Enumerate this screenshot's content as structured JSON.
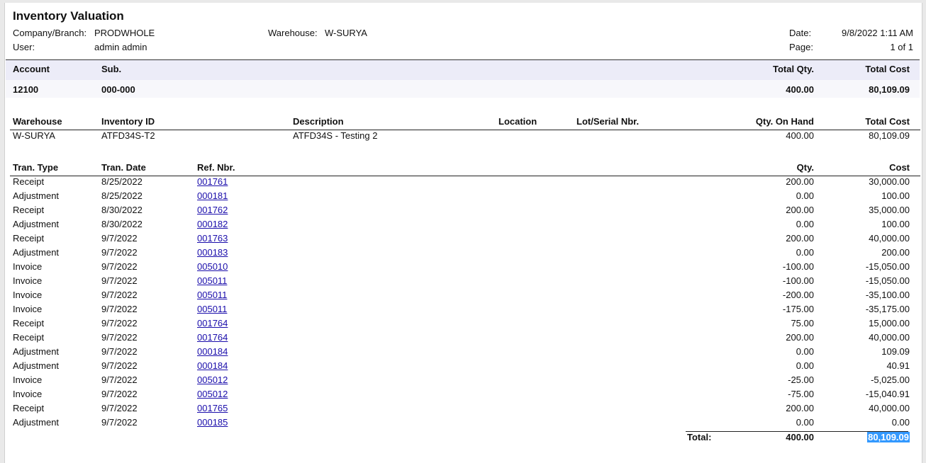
{
  "report": {
    "title": "Inventory Valuation",
    "company_label": "Company/Branch:",
    "company_value": "PRODWHOLE",
    "user_label": "User:",
    "user_value": "admin admin",
    "warehouse_label": "Warehouse:",
    "warehouse_value": "W-SURYA",
    "date_label": "Date:",
    "date_value": "9/8/2022 1:11 AM",
    "page_label": "Page:",
    "page_value": "1 of 1"
  },
  "account_header": {
    "account": "Account",
    "sub": "Sub.",
    "total_qty": "Total Qty.",
    "total_cost": "Total Cost"
  },
  "account_row": {
    "account": "12100",
    "sub": "000-000",
    "total_qty": "400.00",
    "total_cost": "80,109.09"
  },
  "item_header": {
    "warehouse": "Warehouse",
    "inventory_id": "Inventory ID",
    "description": "Description",
    "location": "Location",
    "lot_serial": "Lot/Serial Nbr.",
    "qty_on_hand": "Qty. On Hand",
    "total_cost": "Total Cost"
  },
  "item_row": {
    "warehouse": "W-SURYA",
    "inventory_id": "ATFD34S-T2",
    "description": "ATFD34S - Testing 2",
    "qty_on_hand": "400.00",
    "total_cost": "80,109.09"
  },
  "tran_header": {
    "type": "Tran. Type",
    "date": "Tran. Date",
    "ref": "Ref. Nbr.",
    "qty": "Qty.",
    "cost": "Cost"
  },
  "transactions": [
    {
      "type": "Receipt",
      "date": "8/25/2022",
      "ref": "001761",
      "qty": "200.00",
      "cost": "30,000.00"
    },
    {
      "type": "Adjustment",
      "date": "8/25/2022",
      "ref": "000181",
      "qty": "0.00",
      "cost": "100.00"
    },
    {
      "type": "Receipt",
      "date": "8/30/2022",
      "ref": "001762",
      "qty": "200.00",
      "cost": "35,000.00"
    },
    {
      "type": "Adjustment",
      "date": "8/30/2022",
      "ref": "000182",
      "qty": "0.00",
      "cost": "100.00"
    },
    {
      "type": "Receipt",
      "date": "9/7/2022",
      "ref": "001763",
      "qty": "200.00",
      "cost": "40,000.00"
    },
    {
      "type": "Adjustment",
      "date": "9/7/2022",
      "ref": "000183",
      "qty": "0.00",
      "cost": "200.00"
    },
    {
      "type": "Invoice",
      "date": "9/7/2022",
      "ref": "005010",
      "qty": "-100.00",
      "cost": "-15,050.00"
    },
    {
      "type": "Invoice",
      "date": "9/7/2022",
      "ref": "005011",
      "qty": "-100.00",
      "cost": "-15,050.00"
    },
    {
      "type": "Invoice",
      "date": "9/7/2022",
      "ref": "005011",
      "qty": "-200.00",
      "cost": "-35,100.00"
    },
    {
      "type": "Invoice",
      "date": "9/7/2022",
      "ref": "005011",
      "qty": "-175.00",
      "cost": "-35,175.00"
    },
    {
      "type": "Receipt",
      "date": "9/7/2022",
      "ref": "001764",
      "qty": "75.00",
      "cost": "15,000.00"
    },
    {
      "type": "Receipt",
      "date": "9/7/2022",
      "ref": "001764",
      "qty": "200.00",
      "cost": "40,000.00"
    },
    {
      "type": "Adjustment",
      "date": "9/7/2022",
      "ref": "000184",
      "qty": "0.00",
      "cost": "109.09"
    },
    {
      "type": "Adjustment",
      "date": "9/7/2022",
      "ref": "000184",
      "qty": "0.00",
      "cost": "40.91"
    },
    {
      "type": "Invoice",
      "date": "9/7/2022",
      "ref": "005012",
      "qty": "-25.00",
      "cost": "-5,025.00"
    },
    {
      "type": "Invoice",
      "date": "9/7/2022",
      "ref": "005012",
      "qty": "-75.00",
      "cost": "-15,040.91"
    },
    {
      "type": "Receipt",
      "date": "9/7/2022",
      "ref": "001765",
      "qty": "200.00",
      "cost": "40,000.00"
    },
    {
      "type": "Adjustment",
      "date": "9/7/2022",
      "ref": "000185",
      "qty": "0.00",
      "cost": "0.00"
    }
  ],
  "total": {
    "label": "Total:",
    "qty": "400.00",
    "cost": "80,109.09"
  }
}
